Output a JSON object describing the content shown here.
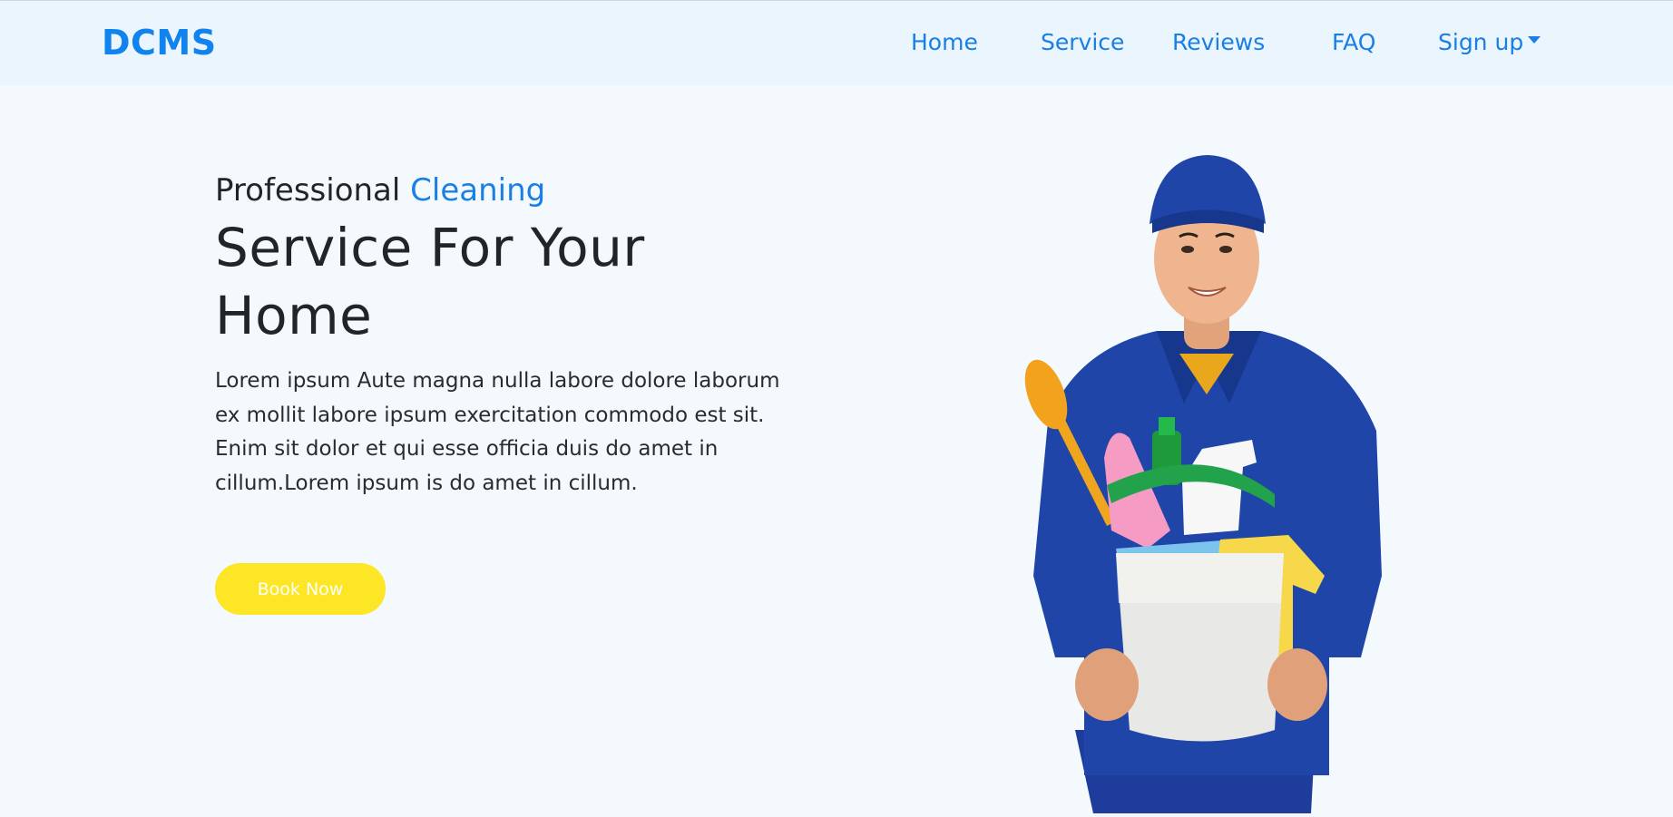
{
  "brand": {
    "name": "DCMS",
    "color": "#1083ee"
  },
  "nav": {
    "items": [
      {
        "label": "Home"
      },
      {
        "label": "Service"
      },
      {
        "label": "Reviews"
      },
      {
        "label": "FAQ"
      },
      {
        "label": "Sign up",
        "has_dropdown": true
      }
    ]
  },
  "hero": {
    "subtitle_prefix": "Professional",
    "subtitle_accent": "Cleaning",
    "headline": "Service For Your Home",
    "description": "Lorem ipsum Aute magna nulla labore dolore laborum ex mollit labore ipsum exercitation commodo est sit. Enim sit dolor et qui esse officia duis do amet in cillum.Lorem ipsum is do amet in cillum.",
    "cta_label": "Book Now",
    "cta_color": "#fde626",
    "image_icon": "cleaner-with-bucket-illustration"
  },
  "colors": {
    "accent": "#1a7fe4",
    "page_bg": "#f4f9fe",
    "navbar_bg": "#eaf5fe"
  }
}
